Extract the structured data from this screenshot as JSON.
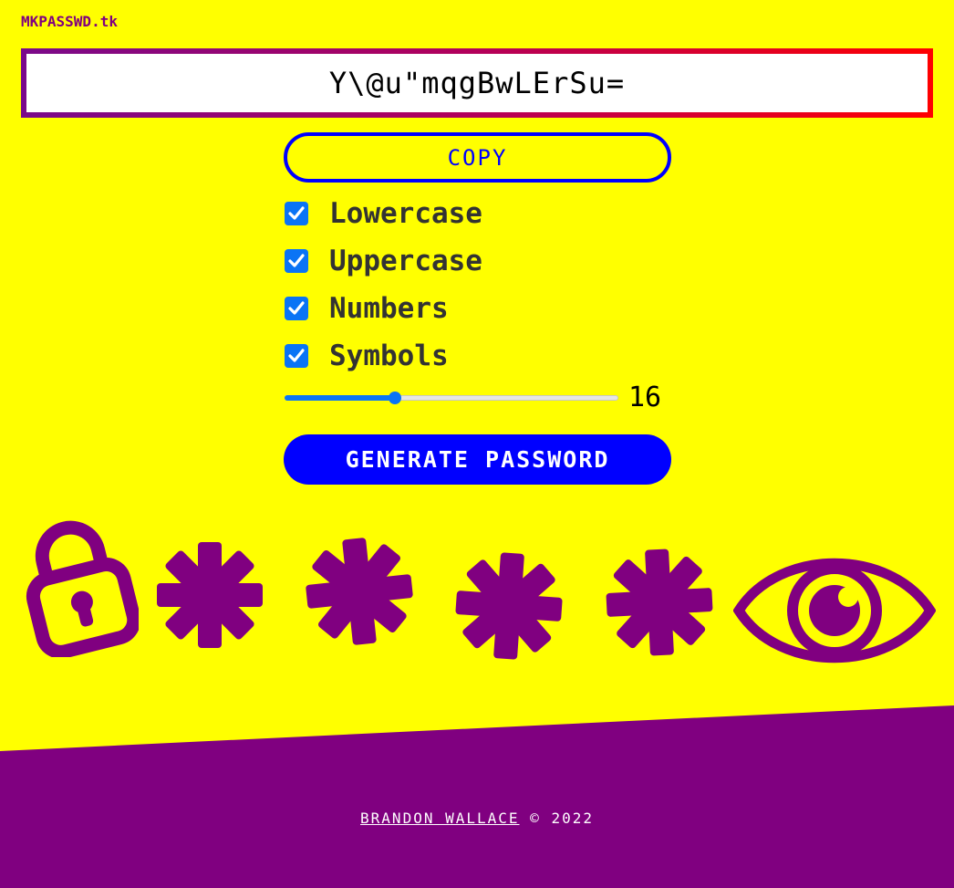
{
  "brand": {
    "label": "MKPASSWD.tk"
  },
  "password": {
    "value": "Y\\@u\"mqgBwLErSu="
  },
  "copy_button": {
    "label": "COPY"
  },
  "options": [
    {
      "label": "Lowercase",
      "checked": true
    },
    {
      "label": "Uppercase",
      "checked": true
    },
    {
      "label": "Numbers",
      "checked": true
    },
    {
      "label": "Symbols",
      "checked": true
    }
  ],
  "length": {
    "value": "16",
    "slider_fraction": 0.33
  },
  "generate_button": {
    "label": "GENERATE PASSWORD"
  },
  "decorations": [
    "lock-icon",
    "asterisk-icon",
    "asterisk-icon",
    "asterisk-icon",
    "asterisk-icon",
    "eye-icon"
  ],
  "footer": {
    "author": "BRANDON WALLACE",
    "copyright": "© 2022"
  },
  "colors": {
    "background": "#ffff00",
    "accent_purple": "#800080",
    "accent_blue": "#0000ff",
    "checkbox_blue": "#0a74f5"
  }
}
